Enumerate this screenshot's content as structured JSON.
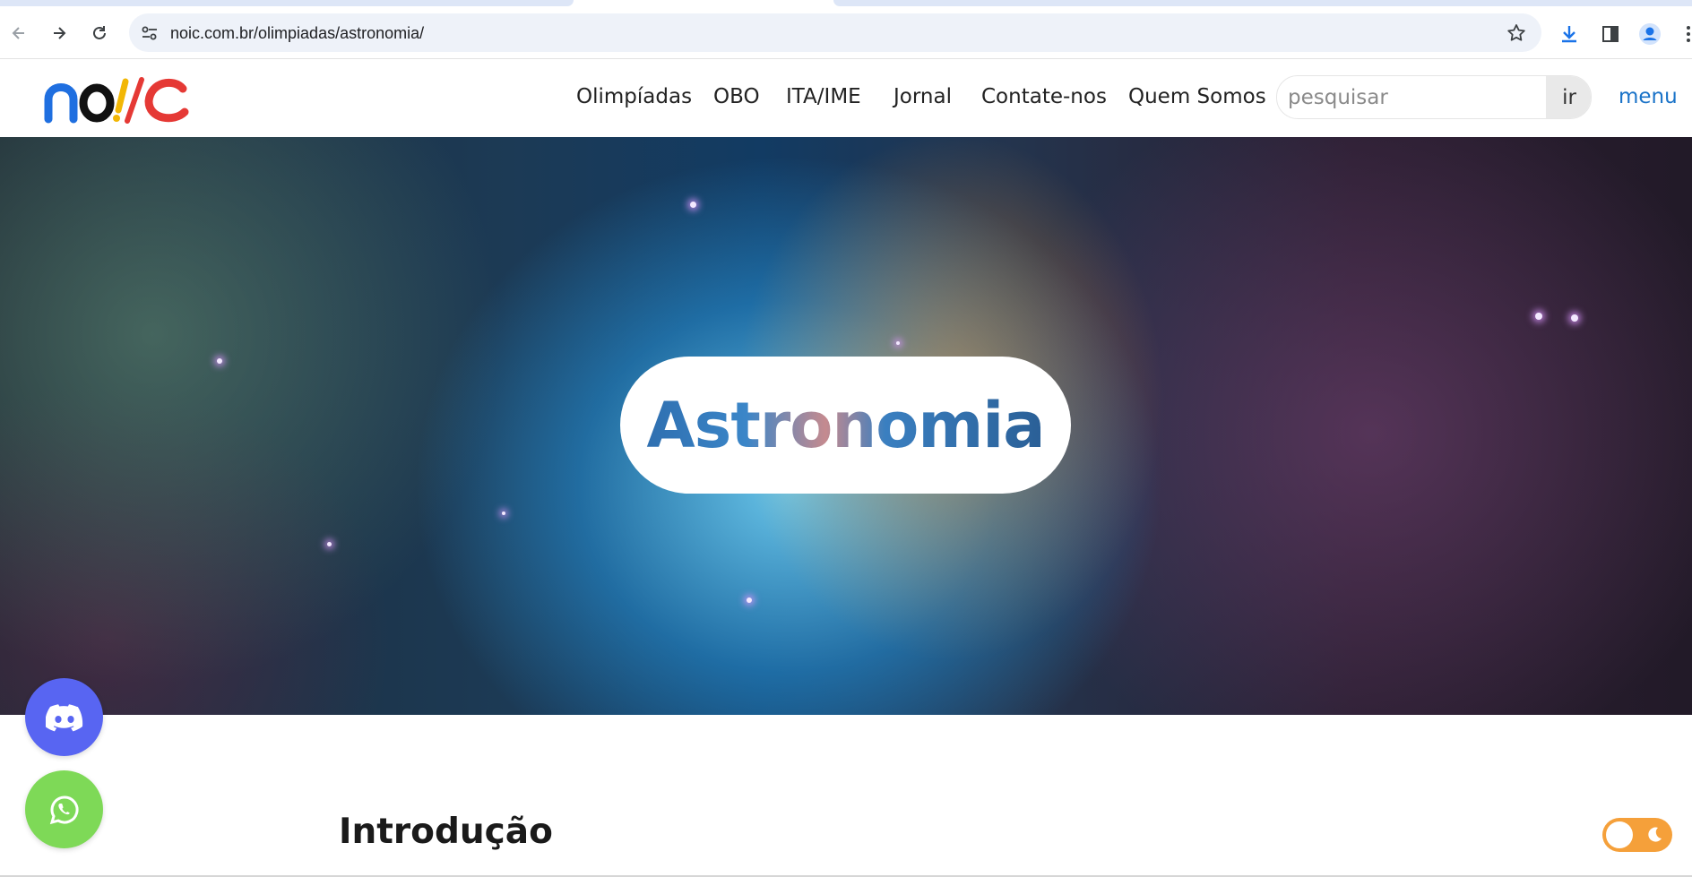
{
  "browser": {
    "url": "noic.com.br/olimpiadas/astronomia/",
    "icons": {
      "back": "arrow-left-icon",
      "forward": "arrow-right-icon",
      "reload": "reload-icon",
      "site_info": "tune-icon",
      "bookmark": "star-icon",
      "download": "download-icon",
      "side_panel": "side-panel-icon",
      "profile": "profile-icon",
      "more": "more-vertical-icon"
    }
  },
  "site": {
    "logo_text": "noic",
    "nav": [
      "Olimpíadas",
      "OBO",
      "ITA/IME",
      "Jornal",
      "Contate-nos",
      "Quem Somos"
    ],
    "search": {
      "placeholder": "pesquisar",
      "button_label": "ir"
    },
    "menu_label": "menu",
    "accent_color": "#1a73c8"
  },
  "hero": {
    "title": "Astronomia"
  },
  "floating": {
    "discord_icon": "discord-icon",
    "whatsapp_icon": "whatsapp-icon",
    "discord_color": "#5865f2",
    "whatsapp_color": "#7ed957"
  },
  "content": {
    "section_title": "Introdução"
  },
  "theme_toggle": {
    "icon": "moon-icon",
    "color": "#f5a03a"
  }
}
